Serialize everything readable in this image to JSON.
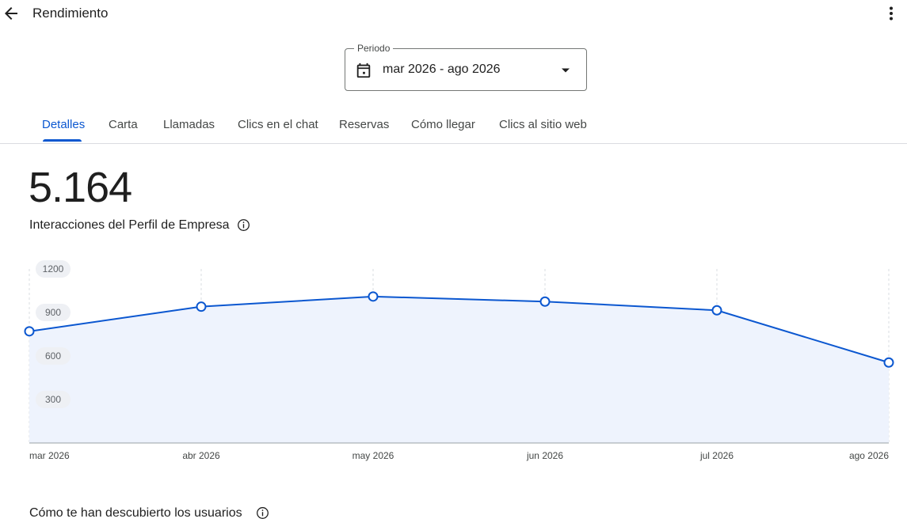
{
  "header": {
    "title": "Rendimiento"
  },
  "period": {
    "legend": "Periodo",
    "value": "mar 2026 - ago 2026"
  },
  "tabs": [
    {
      "label": "Detalles"
    },
    {
      "label": "Carta"
    },
    {
      "label": "Llamadas"
    },
    {
      "label": "Clics en el chat"
    },
    {
      "label": "Reservas"
    },
    {
      "label": "Cómo llegar"
    },
    {
      "label": "Clics al sitio web"
    }
  ],
  "active_tab": "Detalles",
  "metric": {
    "value": "5.164",
    "label": "Interacciones del Perfil de Empresa"
  },
  "chart_data": {
    "type": "area",
    "categories": [
      "mar 2026",
      "abr 2026",
      "may 2026",
      "jun 2026",
      "jul 2026",
      "ago 2026"
    ],
    "series": [
      {
        "values": [
          770,
          940,
          1010,
          975,
          915,
          555
        ]
      }
    ],
    "yticks": [
      300,
      600,
      900,
      1200
    ],
    "ylim": [
      0,
      1200
    ],
    "grid": "vertical-dashed",
    "color": "#0b57d0",
    "fill": "#eef3fd"
  },
  "discovery": {
    "title": "Cómo te han descubierto los usuarios"
  },
  "icons": {
    "back": "arrow-left-icon",
    "more": "more-vert-icon",
    "calendar": "calendar-icon",
    "dropdown": "dropdown-arrow-icon",
    "info": "info-icon"
  }
}
